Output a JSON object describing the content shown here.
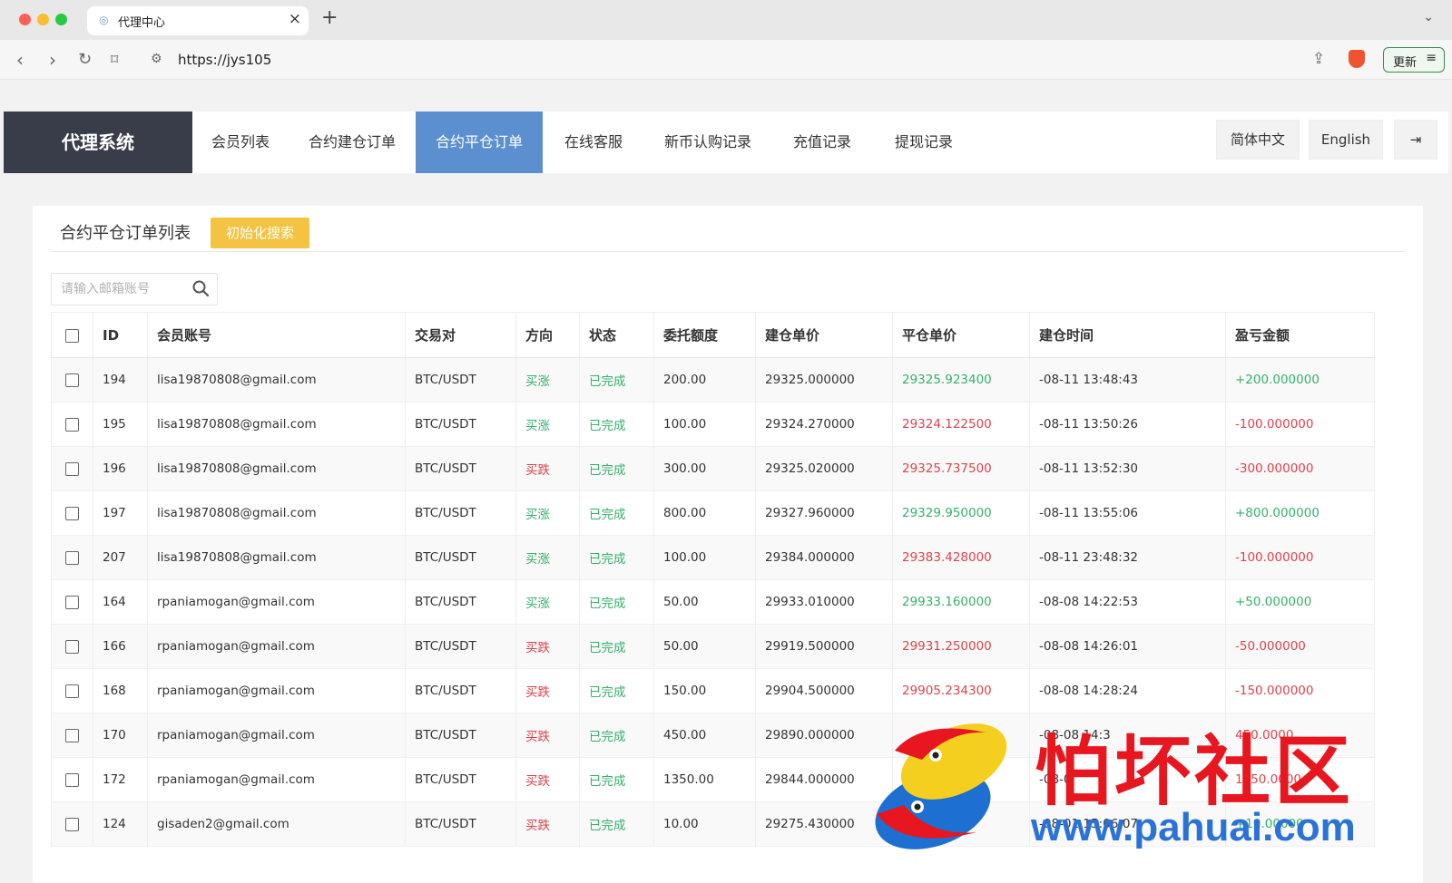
{
  "browser": {
    "tab_title": "代理中心",
    "url": "https://jys105",
    "update_label": "更新"
  },
  "nav": {
    "brand": "代理系统",
    "items": [
      {
        "label": "会员列表"
      },
      {
        "label": "合约建仓订单"
      },
      {
        "label": "合约平仓订单",
        "active": true
      },
      {
        "label": "在线客服"
      },
      {
        "label": "新币认购记录"
      },
      {
        "label": "充值记录"
      },
      {
        "label": "提现记录"
      }
    ],
    "lang_zh": "简体中文",
    "lang_en": "English"
  },
  "page": {
    "title": "合约平仓订单列表",
    "reset_label": "初始化搜索",
    "search_placeholder": "请输入邮箱账号"
  },
  "table": {
    "columns": [
      "ID",
      "会员账号",
      "交易对",
      "方向",
      "状态",
      "委托额度",
      "建仓单价",
      "平仓单价",
      "建仓时间",
      "盈亏金额"
    ],
    "rows": [
      {
        "id": "194",
        "account": "lisa19870808@gmail.com",
        "pair": "BTC/USDT",
        "direction": "买涨",
        "status": "已完成",
        "amount": "200.00",
        "open_price": "29325.000000",
        "close_price": "29325.923400",
        "open_time": "-08-11 13:48:43",
        "pnl": "+200.000000"
      },
      {
        "id": "195",
        "account": "lisa19870808@gmail.com",
        "pair": "BTC/USDT",
        "direction": "买涨",
        "status": "已完成",
        "amount": "100.00",
        "open_price": "29324.270000",
        "close_price": "29324.122500",
        "open_time": "-08-11 13:50:26",
        "pnl": "-100.000000"
      },
      {
        "id": "196",
        "account": "lisa19870808@gmail.com",
        "pair": "BTC/USDT",
        "direction": "买跌",
        "status": "已完成",
        "amount": "300.00",
        "open_price": "29325.020000",
        "close_price": "29325.737500",
        "open_time": "-08-11 13:52:30",
        "pnl": "-300.000000"
      },
      {
        "id": "197",
        "account": "lisa19870808@gmail.com",
        "pair": "BTC/USDT",
        "direction": "买涨",
        "status": "已完成",
        "amount": "800.00",
        "open_price": "29327.960000",
        "close_price": "29329.950000",
        "open_time": "-08-11 13:55:06",
        "pnl": "+800.000000"
      },
      {
        "id": "207",
        "account": "lisa19870808@gmail.com",
        "pair": "BTC/USDT",
        "direction": "买涨",
        "status": "已完成",
        "amount": "100.00",
        "open_price": "29384.000000",
        "close_price": "29383.428000",
        "open_time": "-08-11 23:48:32",
        "pnl": "-100.000000"
      },
      {
        "id": "164",
        "account": "rpaniamogan@gmail.com",
        "pair": "BTC/USDT",
        "direction": "买涨",
        "status": "已完成",
        "amount": "50.00",
        "open_price": "29933.010000",
        "close_price": "29933.160000",
        "open_time": "-08-08 14:22:53",
        "pnl": "+50.000000"
      },
      {
        "id": "166",
        "account": "rpaniamogan@gmail.com",
        "pair": "BTC/USDT",
        "direction": "买跌",
        "status": "已完成",
        "amount": "50.00",
        "open_price": "29919.500000",
        "close_price": "29931.250000",
        "open_time": "-08-08 14:26:01",
        "pnl": "-50.000000"
      },
      {
        "id": "168",
        "account": "rpaniamogan@gmail.com",
        "pair": "BTC/USDT",
        "direction": "买跌",
        "status": "已完成",
        "amount": "150.00",
        "open_price": "29904.500000",
        "close_price": "29905.234300",
        "open_time": "-08-08 14:28:24",
        "pnl": "-150.000000"
      },
      {
        "id": "170",
        "account": "rpaniamogan@gmail.com",
        "pair": "BTC/USDT",
        "direction": "买跌",
        "status": "已完成",
        "amount": "450.00",
        "open_price": "29890.000000",
        "close_price": "",
        "open_time": "-08-08 14:3",
        "pnl": "450.0000"
      },
      {
        "id": "172",
        "account": "rpaniamogan@gmail.com",
        "pair": "BTC/USDT",
        "direction": "买跌",
        "status": "已完成",
        "amount": "1350.00",
        "open_price": "29844.000000",
        "close_price": "",
        "open_time": "-08-0",
        "pnl": "1350.0000"
      },
      {
        "id": "124",
        "account": "gisaden2@gmail.com",
        "pair": "BTC/USDT",
        "direction": "买跌",
        "status": "已完成",
        "amount": "10.00",
        "open_price": "29275.430000",
        "close_price": "",
        "open_time": "-08-01 15:06:07",
        "pnl": "+10.00000"
      }
    ]
  },
  "watermark": {
    "title": "怕坏社区",
    "url": "www.pahuai.com"
  }
}
